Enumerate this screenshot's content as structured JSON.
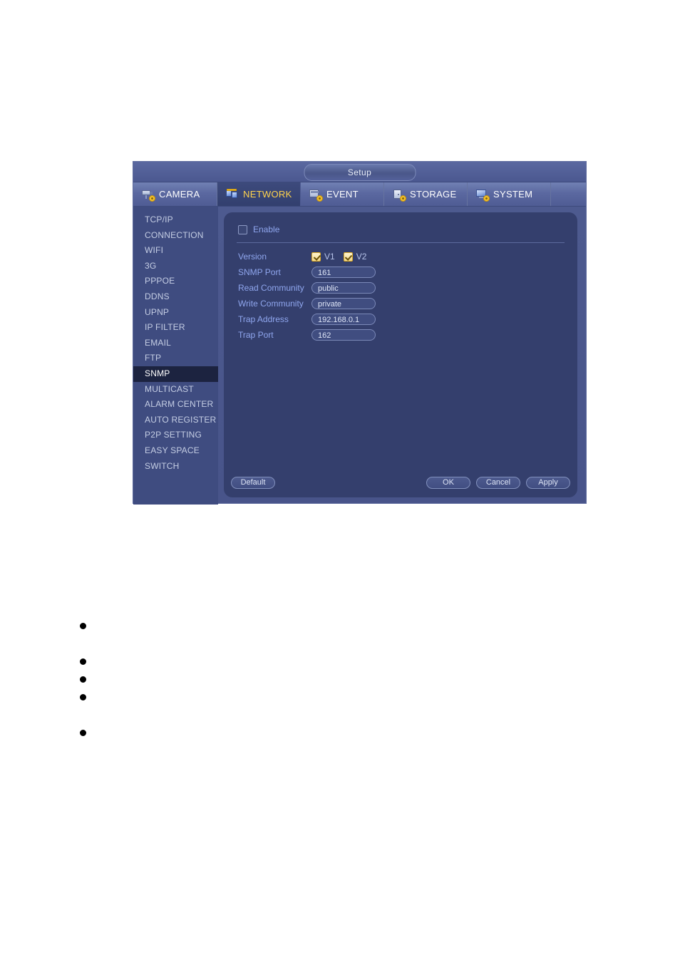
{
  "window": {
    "title": "Setup"
  },
  "tabs": [
    {
      "label": "CAMERA",
      "icon": "camera-icon",
      "active": false
    },
    {
      "label": "NETWORK",
      "icon": "network-icon",
      "active": true
    },
    {
      "label": "EVENT",
      "icon": "event-icon",
      "active": false
    },
    {
      "label": "STORAGE",
      "icon": "storage-icon",
      "active": false
    },
    {
      "label": "SYSTEM",
      "icon": "system-icon",
      "active": false
    }
  ],
  "sidebar": {
    "selected": "SNMP",
    "items": [
      {
        "label": "TCP/IP"
      },
      {
        "label": "CONNECTION"
      },
      {
        "label": "WIFI"
      },
      {
        "label": "3G"
      },
      {
        "label": "PPPOE"
      },
      {
        "label": "DDNS"
      },
      {
        "label": "UPNP"
      },
      {
        "label": "IP FILTER"
      },
      {
        "label": "EMAIL"
      },
      {
        "label": "FTP"
      },
      {
        "label": "SNMP"
      },
      {
        "label": "MULTICAST"
      },
      {
        "label": "ALARM CENTER"
      },
      {
        "label": "AUTO REGISTER"
      },
      {
        "label": "P2P SETTING"
      },
      {
        "label": "EASY SPACE"
      },
      {
        "label": "SWITCH"
      }
    ]
  },
  "form": {
    "enable": {
      "label": "Enable",
      "checked": false
    },
    "version": {
      "label": "Version",
      "v1": {
        "label": "V1",
        "checked": true
      },
      "v2": {
        "label": "V2",
        "checked": true
      }
    },
    "snmp_port": {
      "label": "SNMP Port",
      "value": "161"
    },
    "read_community": {
      "label": "Read Community",
      "value": "public"
    },
    "write_community": {
      "label": "Write Community",
      "value": "private"
    },
    "trap_address": {
      "label": "Trap Address",
      "value": "192.168.0.1"
    },
    "trap_port": {
      "label": "Trap Port",
      "value": "162"
    }
  },
  "footer": {
    "default": "Default",
    "ok": "OK",
    "cancel": "Cancel",
    "apply": "Apply"
  },
  "colors": {
    "window_bg": "#49558a",
    "panel_bg": "#343f6d",
    "sidebar_bg": "#3f4c80",
    "selected_item_bg": "#1c2340",
    "label_blue": "#8fa6ee",
    "active_tab_text": "#ffd34d",
    "checkbox_on": "#f2d98c"
  },
  "bullets": [
    {
      "index": 1
    },
    {
      "index": 2
    },
    {
      "index": 3
    },
    {
      "index": 4
    },
    {
      "index": 5
    }
  ]
}
